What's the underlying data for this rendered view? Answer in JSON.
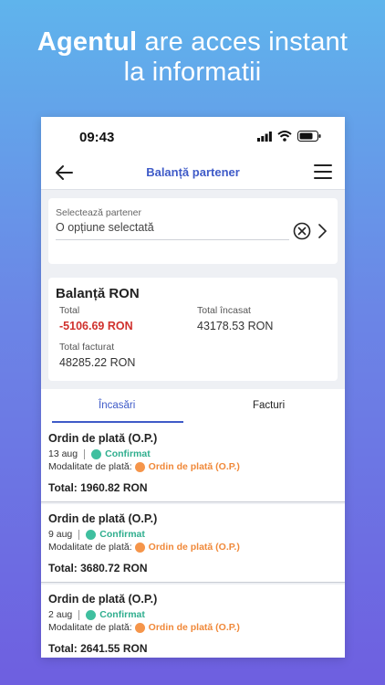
{
  "promo": {
    "headline_bold": "Agentul",
    "headline_rest": " are acces instant",
    "headline_line2": "la informatii"
  },
  "statusbar": {
    "time": "09:43"
  },
  "navbar": {
    "title": "Balanță partener"
  },
  "partner": {
    "label": "Selectează partener",
    "value": "O opțiune selectată"
  },
  "balance": {
    "title": "Balanță RON",
    "total_label": "Total",
    "total_value": "-5106.69 RON",
    "incasat_label": "Total încasat",
    "incasat_value": "43178.53 RON",
    "facturat_label": "Total facturat",
    "facturat_value": "48285.22 RON"
  },
  "tabs": [
    {
      "label": "Încasări",
      "active": true
    },
    {
      "label": "Facturi",
      "active": false
    }
  ],
  "items": [
    {
      "title": "Ordin de plată (O.P.)",
      "date": "13 aug",
      "status": "Confirmat",
      "mode_label": "Modalitate de plată:",
      "mode_value": "Ordin de plată (O.P.)",
      "total": "Total: 1960.82 RON"
    },
    {
      "title": "Ordin de plată (O.P.)",
      "date": "9 aug",
      "status": "Confirmat",
      "mode_label": "Modalitate de plată:",
      "mode_value": "Ordin de plată (O.P.)",
      "total": "Total: 3680.72 RON"
    },
    {
      "title": "Ordin de plată (O.P.)",
      "date": "2 aug",
      "status": "Confirmat",
      "mode_label": "Modalitate de plată:",
      "mode_value": "Ordin de plată (O.P.)",
      "total": "Total: 2641.55 RON"
    }
  ]
}
